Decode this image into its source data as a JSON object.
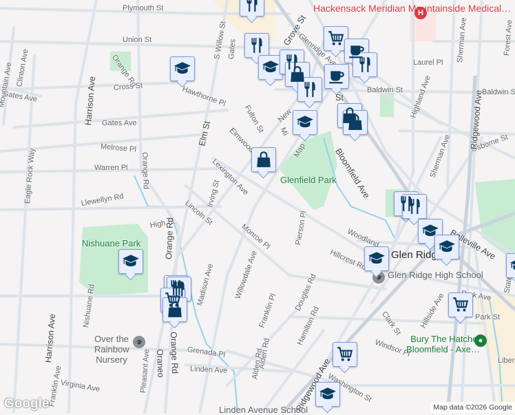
{
  "map": {
    "streets": [
      "Plymouth St",
      "Union St",
      "S Willow St",
      "Grove St",
      "Glenridge Ave",
      "Orange Rd",
      "Clinton Ave",
      "Harrison Ave",
      "Cross St",
      "Hawthorne Pl",
      "Gates Ave",
      "Melrose Pl",
      "Warren Pl",
      "Elm St",
      "Fulton St",
      "Elmwood",
      "Lexington Ave",
      "Irving St",
      "Lincoln St",
      "Llewellyn Rd",
      "High St",
      "Eagle Rock Way",
      "Monroe Pl",
      "Pierson Pl",
      "Madison Ave",
      "Willowdale Ave",
      "Franklin Pl",
      "Douglas Rd",
      "Hamilton Rd",
      "Alden Rd",
      "Nishuane Rd",
      "Grenada Pl",
      "Linden Ave",
      "Pleasant Ave",
      "Virginia Ave",
      "Franklin Ave",
      "Ridgewood Ave",
      "Washington St",
      "Clark St",
      "Hillside Ave",
      "Park Ave",
      "Park St",
      "State St",
      "Liber",
      "Hillcrest Rd",
      "Woodland",
      "Bloomfield Ave",
      "Belleville Ave",
      "Osborne St",
      "Sherman Ave",
      "Highland Ave",
      "Baldwin St",
      "Laurel Pl",
      "Forest Ave",
      "Gates",
      "New",
      "Mi",
      "Map",
      "Harrison Ave",
      "Orange Rd",
      "Oraneo",
      "Mountain Ave",
      "Clinton Ave",
      "Elm",
      "Windsor Pl"
    ],
    "parks": [
      "Glenfield Park",
      "Nishuane Park"
    ],
    "places": {
      "hospital": "Hackensack Meridian Mountainside Medical…",
      "city": "Glen Ridge",
      "school": "Glen Ridge High School",
      "store": "Bury The Hatchet Bloomfield -  Axe…",
      "nursery": "Over the Rainbow Nursery",
      "linden_school": "Linden Avenue School",
      "station": "St"
    },
    "attribution": "Map data ©2026 Google",
    "logo": "Google",
    "colors": {
      "marker_fill": "#e8eefc",
      "marker_icon": "#0b3d62",
      "hospital": "#d93a45",
      "store": "#188038",
      "park": "#c7ecd1"
    }
  }
}
